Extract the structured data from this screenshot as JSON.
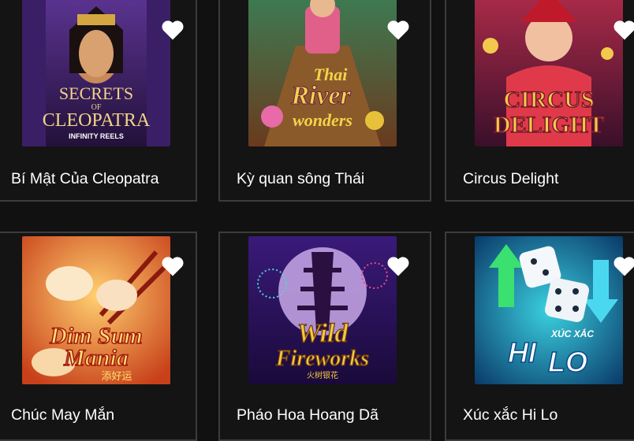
{
  "games": [
    {
      "title": "Bí Mật Của Cleopatra",
      "art_text": [
        "SECRETS",
        "OF",
        "CLEOPATRA"
      ],
      "art_sub": "INFINITY REELS",
      "theme": [
        "#4a2a7a",
        "#2a1640",
        "#d4a642"
      ]
    },
    {
      "title": "Kỳ quan sông Thái",
      "art_text": [
        "Thai",
        "River",
        "wonders"
      ],
      "theme": [
        "#2f6a4a",
        "#7a4a2a",
        "#e8c13a"
      ]
    },
    {
      "title": "Circus Delight",
      "art_text": [
        "CIRCUS",
        "DELIGHT"
      ],
      "theme": [
        "#7a1a3a",
        "#3a0f2a",
        "#f2c94c"
      ]
    },
    {
      "title": "Chúc May Mắn",
      "art_text": [
        "Dim Sum",
        "Mania"
      ],
      "art_sub": "添好运",
      "theme": [
        "#f0a030",
        "#c04a10",
        "#ffe070"
      ]
    },
    {
      "title": "Pháo Hoa Hoang Dã",
      "art_text": [
        "Wild",
        "Fireworks"
      ],
      "art_sub": "火树银花",
      "theme": [
        "#5a2a9a",
        "#2a1050",
        "#f5c842"
      ]
    },
    {
      "title": "Xúc xắc Hi Lo",
      "art_text": [
        "HI",
        "LO"
      ],
      "art_sub": "XÚC XẮC",
      "theme": [
        "#1aa0c0",
        "#0a3a6a",
        "#ffffff"
      ]
    }
  ],
  "colors": {
    "background": "#111111",
    "card_border": "#3c3c3c",
    "title_text": "#ffffff",
    "favorite_icon": "#ffffff"
  }
}
